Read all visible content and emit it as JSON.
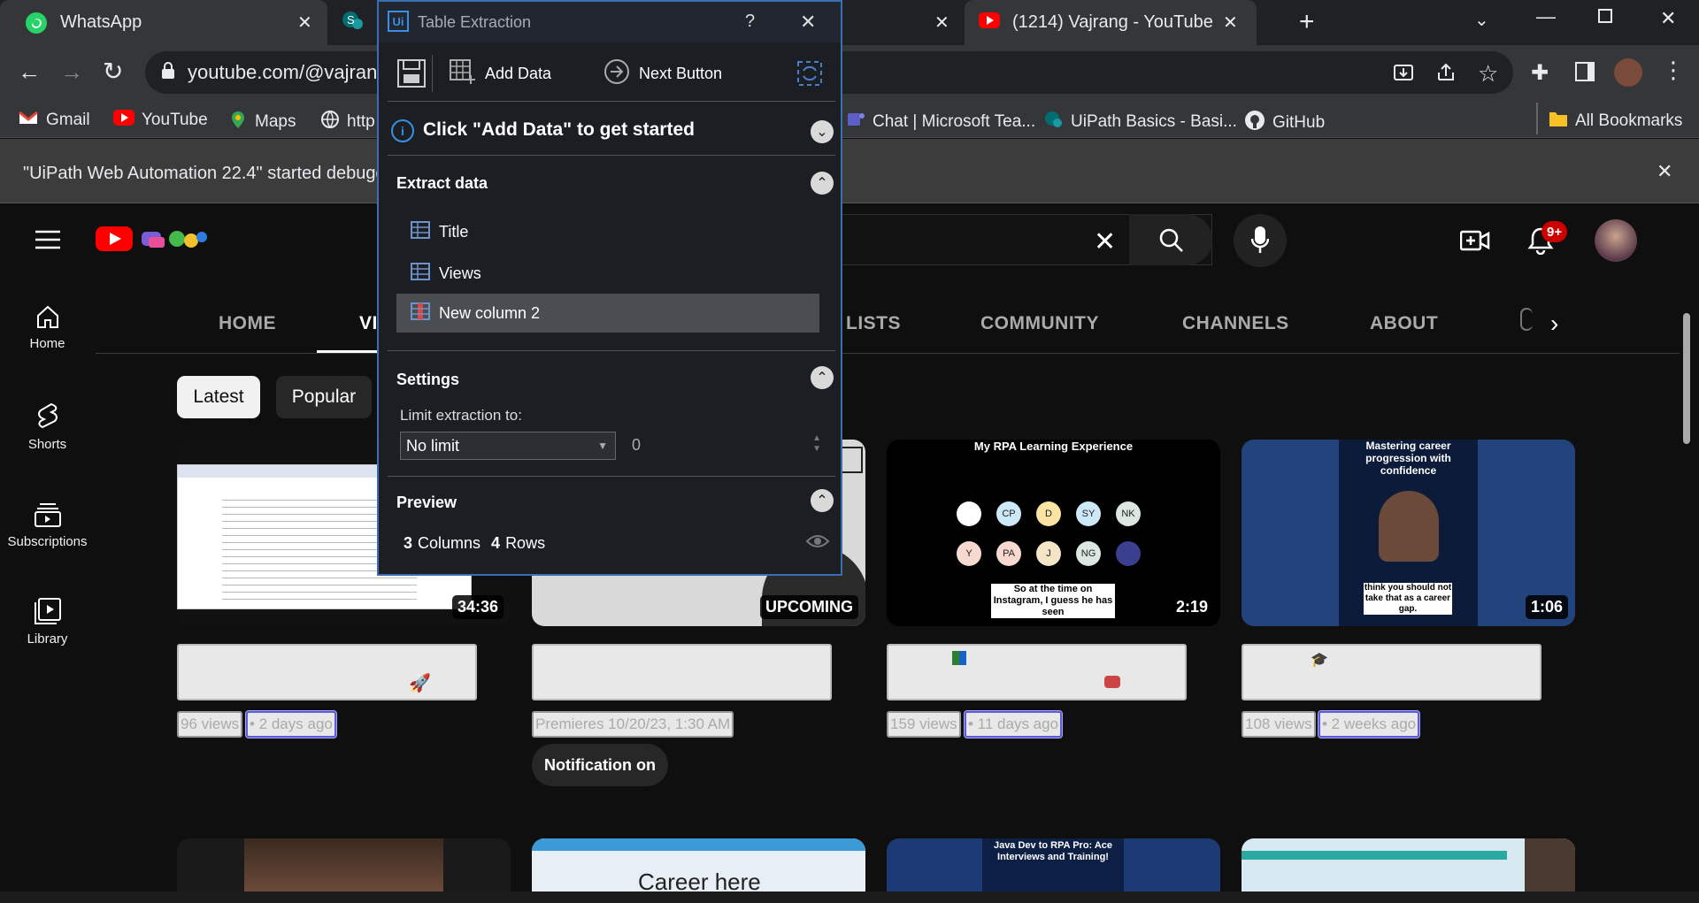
{
  "browser": {
    "tabs": [
      {
        "title": "WhatsApp"
      },
      {
        "title": "(1214) Vajrang - YouTube"
      }
    ],
    "address": "youtube.com/@vajrang",
    "bookmarks": [
      "Gmail",
      "YouTube",
      "Maps",
      "http",
      "Chat | Microsoft Tea...",
      "UiPath Basics - Basi...",
      "GitHub"
    ],
    "all_bookmarks": "All Bookmarks",
    "infobar_text": "\"UiPath Web Automation 22.4\" started debugg",
    "accent": "#3a6fb5"
  },
  "youtube": {
    "sidebar": [
      {
        "label": "Home",
        "icon": "home-icon"
      },
      {
        "label": "Shorts",
        "icon": "shorts-icon"
      },
      {
        "label": "Subscriptions",
        "icon": "subscriptions-icon"
      },
      {
        "label": "Library",
        "icon": "library-icon"
      }
    ],
    "notification_count": "9+",
    "channel_tabs": [
      "HOME",
      "VI",
      "LISTS",
      "COMMUNITY",
      "CHANNELS",
      "ABOUT"
    ],
    "chips": [
      "Latest",
      "Popular"
    ],
    "videos": [
      {
        "duration": "34:36",
        "views": "96 views",
        "age": "• 2 days ago"
      },
      {
        "duration": "UPCOMING",
        "premiere": "Premieres 10/20/23, 1:30 AM",
        "button": "Notification on"
      },
      {
        "duration": "2:19",
        "views": "159 views",
        "age": "• 11 days ago",
        "thumb_title": "My RPA Learning Experience",
        "thumb_caption": "So at the time on Instagram, I guess he has seen",
        "circles": [
          "CP",
          "D",
          "SY",
          "NK",
          "Y",
          "PA",
          "J",
          "NG"
        ]
      },
      {
        "duration": "1:06",
        "views": "108 views",
        "age": "• 2 weeks ago",
        "thumb_title": "Mastering career progression with confidence",
        "thumb_caption": "think you should not take that as a career gap."
      }
    ],
    "row2": [
      "",
      "Career here",
      "Java Dev to RPA Pro: Ace Interviews and Training!",
      ""
    ]
  },
  "panel": {
    "title": "Table Extraction",
    "help": "?",
    "add_data": "Add Data",
    "next_button": "Next Button",
    "banner": "Click \"Add Data\" to get started",
    "extract_header": "Extract data",
    "columns": [
      "Title",
      "Views",
      "New column 2"
    ],
    "settings_header": "Settings",
    "limit_label": "Limit extraction to:",
    "limit_value": "No limit",
    "limit_number": "0",
    "preview_header": "Preview",
    "preview_cols": "3",
    "preview_cols_label": "Columns",
    "preview_rows": "4",
    "preview_rows_label": "Rows"
  }
}
